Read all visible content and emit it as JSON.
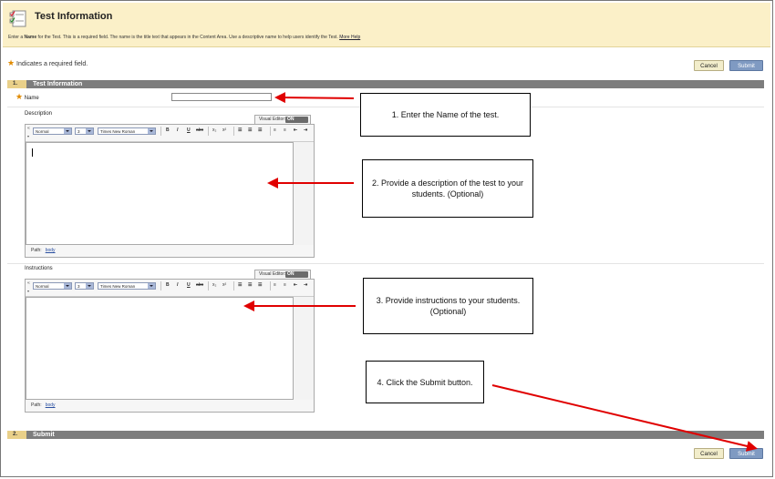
{
  "header": {
    "title": "Test Information",
    "desc_pre": "Enter a ",
    "desc_bold": "Name",
    "desc_post": " for the Test. This is a required field. The name is the title text that appears in the Content Area. Use a descriptive name to help users identify the Test.",
    "more_help": "More Help"
  },
  "required_note": "Indicates a required field.",
  "buttons": {
    "cancel": "Cancel",
    "submit": "Submit"
  },
  "sections": [
    {
      "num": "1.",
      "title": "Test Information"
    },
    {
      "num": "2.",
      "title": "Submit"
    }
  ],
  "fields": {
    "name_label": "Name",
    "name_value": "",
    "description_label": "Description",
    "instructions_label": "Instructions"
  },
  "editor": {
    "visual_editor_label": "Visual Editor:",
    "toggle": "ON",
    "format": "Normal",
    "size": "3",
    "font": "Times New Roman",
    "path_label": "Path:",
    "path_value": "body",
    "bold": "B",
    "italic": "I",
    "underline": "U",
    "strike": "abc",
    "subscript": "x₂",
    "superscript": "x²"
  },
  "callouts": {
    "step1": "1. Enter the Name of the test.",
    "step2": "2. Provide a description of the test to your students. (Optional)",
    "step3": "3. Provide instructions to your students. (Optional)",
    "step4": "4. Click the Submit button."
  },
  "colors": {
    "header_bg": "#fbf0c8",
    "submit_blue": "#7f9ac2",
    "arrow_red": "#e00000",
    "section_bar": "#7d7d7d"
  }
}
